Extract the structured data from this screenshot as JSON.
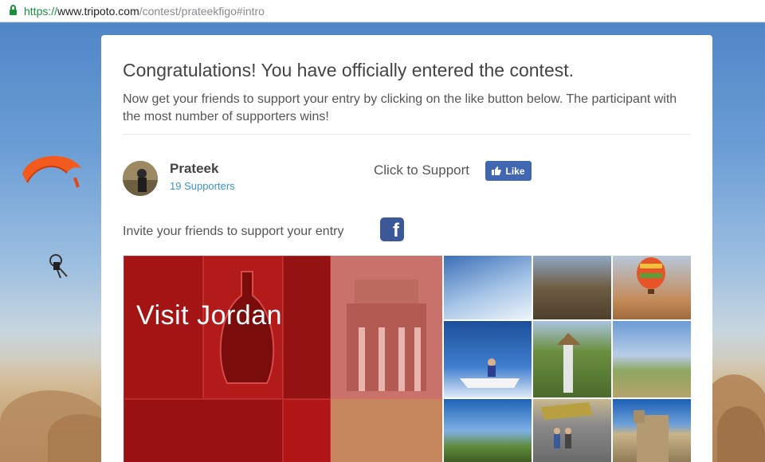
{
  "browser": {
    "url_scheme": "https://",
    "url_domain": "www.tripoto.com",
    "url_path": "/contest/prateekfigo#intro"
  },
  "contest": {
    "title": "Congratulations! You have officially entered the contest.",
    "description": "Now get your friends to support your entry by clicking on the like button below. The participant with the most number of supporters wins!",
    "participant_name": "Prateek",
    "supporters": "19 Supporters",
    "support_label": "Click to Support",
    "like_label": "Like",
    "invite_label": "Invite your friends to support your entry"
  },
  "banner": {
    "title": "Visit Jordan"
  },
  "colors": {
    "facebook": "#4267b2",
    "link": "#3a94d4",
    "secure": "#1a8f3c",
    "banner_red": "#8e1010"
  },
  "icons": [
    "lock-icon",
    "thumbs-up-icon",
    "facebook-icon"
  ]
}
